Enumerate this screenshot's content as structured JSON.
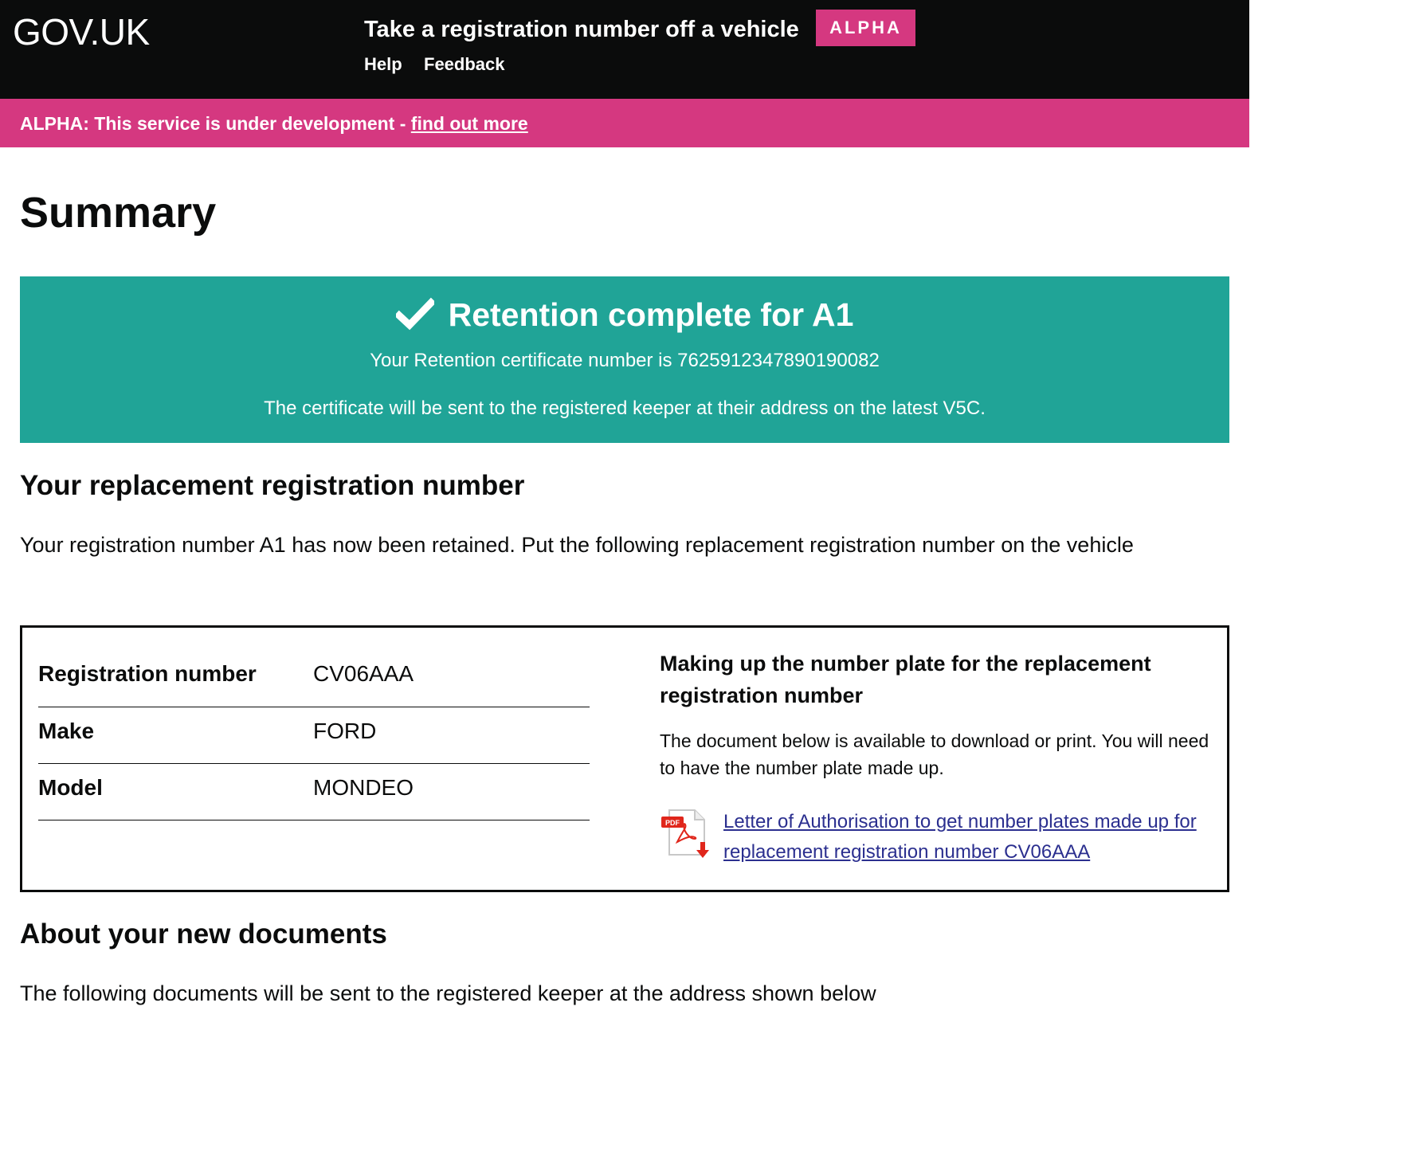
{
  "header": {
    "logo": "GOV.UK",
    "service_name": "Take a registration number off a vehicle",
    "phase_tag": "ALPHA",
    "nav": {
      "help": "Help",
      "feedback": "Feedback"
    }
  },
  "phase_banner": {
    "text": "ALPHA: This service is under development - ",
    "link": "find out more"
  },
  "page_title": "Summary",
  "panel": {
    "heading": "Retention complete for A1",
    "certificate_line": "Your Retention certificate number is 7625912347890190082",
    "info_line": "The certificate will be sent to the registered keeper at their address on the latest V5C."
  },
  "replacement": {
    "heading": "Your replacement registration number",
    "intro": "Your registration number A1 has now been retained. Put the following replacement registration number on the vehicle",
    "rows": [
      {
        "label": "Registration number",
        "value": "CV06AAA"
      },
      {
        "label": "Make",
        "value": "FORD"
      },
      {
        "label": "Model",
        "value": "MONDEO"
      }
    ],
    "plate": {
      "heading": "Making up the number plate for the replacement registration number",
      "description": "The document below is available to download or print. You will need to have the number plate made up.",
      "pdf_badge": "PDF",
      "download_link": "Letter of Authorisation to get number plates made up for replacement registration number CV06AAA"
    }
  },
  "about": {
    "heading": "About your new documents",
    "text": "The following documents will be sent to the registered keeper at the address shown below"
  },
  "colors": {
    "header_bg": "#0b0c0c",
    "alpha_pink": "#d53880",
    "panel_turquoise": "#20a497",
    "link_blue": "#2b2f8f"
  }
}
